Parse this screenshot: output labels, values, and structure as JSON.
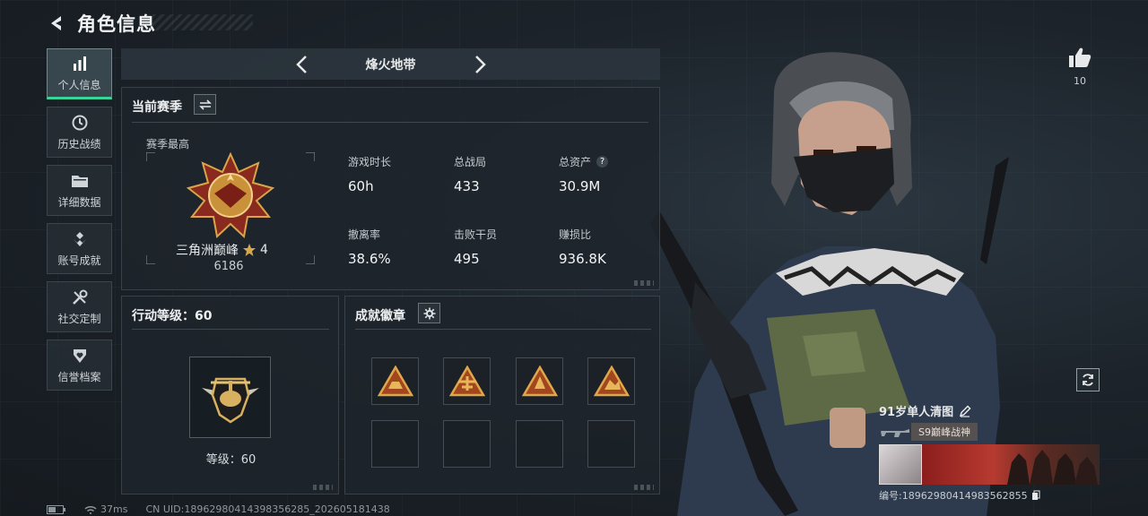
{
  "header": {
    "title": "角色信息"
  },
  "nav": [
    {
      "label": "个人信息",
      "icon": "bar-chart-icon",
      "active": true
    },
    {
      "label": "历史战绩",
      "icon": "clock-icon"
    },
    {
      "label": "详细数据",
      "icon": "folder-icon"
    },
    {
      "label": "账号成就",
      "icon": "achievement-icon"
    },
    {
      "label": "社交定制",
      "icon": "tools-icon"
    },
    {
      "label": "信誉档案",
      "icon": "shield-heart-icon"
    }
  ],
  "mode": {
    "title": "烽火地带"
  },
  "season": {
    "title": "当前赛季",
    "best_label": "赛季最高",
    "rank_name": "三角洲巅峰",
    "rank_stars": "4",
    "rank_points": "6186",
    "stats": [
      {
        "label": "游戏时长",
        "value": "60h"
      },
      {
        "label": "总战局",
        "value": "433"
      },
      {
        "label": "总资产",
        "value": "30.9M",
        "help": "?"
      },
      {
        "label": "撤离率",
        "value": "38.6%"
      },
      {
        "label": "击败干员",
        "value": "495"
      },
      {
        "label": "赚损比",
        "value": "936.8K"
      }
    ]
  },
  "action_level": {
    "title": "行动等级：60",
    "level_text": "等级：60"
  },
  "achievements": {
    "title": "成就徽章"
  },
  "like": {
    "count": "10"
  },
  "player_card": {
    "name": "91岁单人清图",
    "title_tag": "S9巅峰战神",
    "id_text": "编号:18962980414983562855"
  },
  "footer": {
    "ping": "37ms",
    "uid": "CN UID:18962980414398356285_202605181438"
  },
  "colors": {
    "accent": "#39d49a",
    "gold": "#c9923a",
    "background": "#1a1f24"
  }
}
